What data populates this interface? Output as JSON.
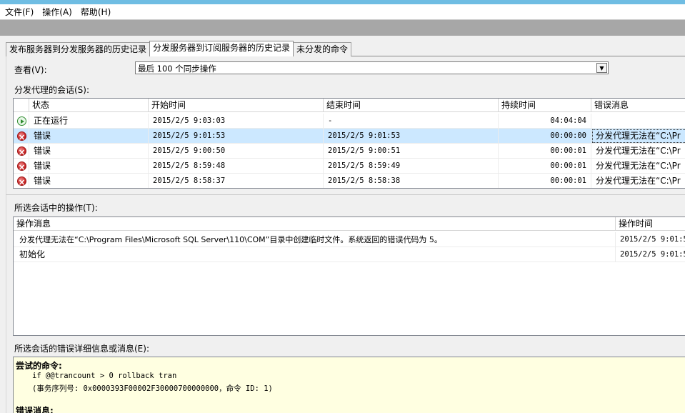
{
  "menu": {
    "file": "文件(F)",
    "action": "操作(A)",
    "help": "帮助(H)"
  },
  "tabs": [
    {
      "label": "发布服务器到分发服务器的历史记录",
      "active": false
    },
    {
      "label": "分发服务器到订阅服务器的历史记录",
      "active": true
    },
    {
      "label": "未分发的命令",
      "active": false
    }
  ],
  "view": {
    "label": "查看(V):",
    "selected": "最后 100 个同步操作"
  },
  "sessions": {
    "label": "分发代理的会话(S):",
    "columns": [
      "状态",
      "开始时间",
      "结束时间",
      "持续时间",
      "错误消息"
    ],
    "rows": [
      {
        "icon": "running-icon",
        "status": "正在运行",
        "start": "2015/2/5 9:03:03",
        "end": "-",
        "duration": "04:04:04",
        "error": "",
        "selected": false
      },
      {
        "icon": "error-icon",
        "status": "错误",
        "start": "2015/2/5 9:01:53",
        "end": "2015/2/5 9:01:53",
        "duration": "00:00:00",
        "error": "分发代理无法在“C:\\Pr",
        "selected": true
      },
      {
        "icon": "error-icon",
        "status": "错误",
        "start": "2015/2/5 9:00:50",
        "end": "2015/2/5 9:00:51",
        "duration": "00:00:01",
        "error": "分发代理无法在“C:\\Pr",
        "selected": false
      },
      {
        "icon": "error-icon",
        "status": "错误",
        "start": "2015/2/5 8:59:48",
        "end": "2015/2/5 8:59:49",
        "duration": "00:00:01",
        "error": "分发代理无法在“C:\\Pr",
        "selected": false
      },
      {
        "icon": "error-icon",
        "status": "错误",
        "start": "2015/2/5 8:58:37",
        "end": "2015/2/5 8:58:38",
        "duration": "00:00:01",
        "error": "分发代理无法在“C:\\Pr",
        "selected": false
      }
    ]
  },
  "actions": {
    "label": "所选会话中的操作(T):",
    "columns": [
      "操作消息",
      "操作时间"
    ],
    "rows": [
      {
        "message": "分发代理无法在“C:\\Program Files\\Microsoft SQL Server\\110\\COM”目录中创建临时文件。系统返回的错误代码为 5。",
        "time": "2015/2/5 9:01:5"
      },
      {
        "message": "初始化",
        "time": "2015/2/5 9:01:5"
      }
    ]
  },
  "details": {
    "label": "所选会话的错误详细信息或消息(E):",
    "command_heading": "尝试的命令:",
    "command_line1": "if @@trancount > 0 rollback tran",
    "command_line2": "(事务序列号: 0x0000393F00002F30000700000000，命令 ID: 1)",
    "error_heading": "错误消息:"
  }
}
